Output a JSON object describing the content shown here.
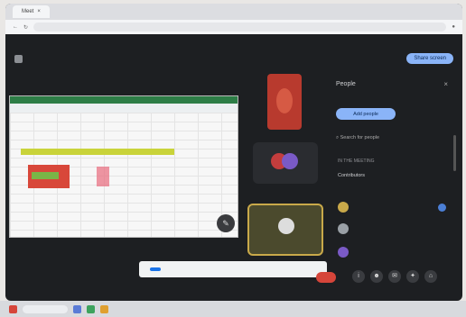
{
  "browser": {
    "tab_label": "Meet",
    "address": ""
  },
  "meeting": {
    "title_label": "",
    "share_button": "Share screen",
    "time_label": "",
    "meeting_code": ""
  },
  "panel": {
    "title": "People",
    "add_button": "Add people",
    "search_placeholder": "Search for people",
    "section_label": "IN THE MEETING",
    "contributors_label": "Contributors",
    "participants": [
      {
        "name": "",
        "color": "#c9a94a"
      },
      {
        "name": "",
        "color": "#9aa0a6"
      },
      {
        "name": "",
        "color": "#7a5ac6"
      }
    ]
  },
  "tiles": {
    "tile2_label": "",
    "tile3_label": ""
  },
  "toast": {
    "message": "",
    "primary_button": "",
    "secondary_button": ""
  },
  "taskbar": {
    "clock": ""
  }
}
